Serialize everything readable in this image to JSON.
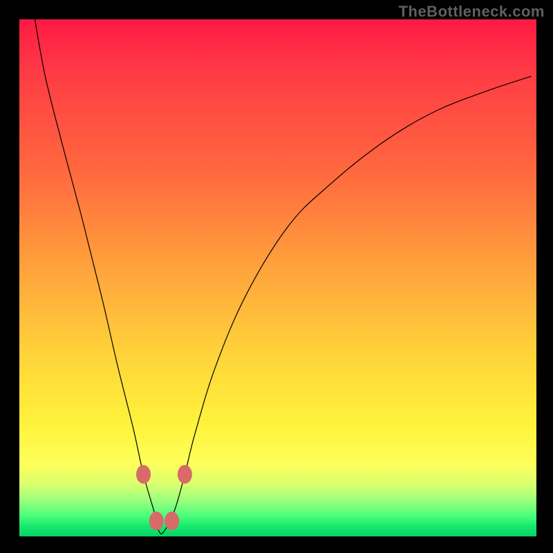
{
  "watermark": "TheBottleneck.com",
  "chart_data": {
    "type": "line",
    "title": "",
    "xlabel": "",
    "ylabel": "",
    "xlim": [
      0,
      100
    ],
    "ylim": [
      0,
      100
    ],
    "series": [
      {
        "name": "bottleneck-curve",
        "x": [
          3,
          5,
          8,
          12,
          16,
          19,
          22,
          24,
          26,
          27,
          28,
          30,
          32,
          34,
          38,
          44,
          52,
          60,
          70,
          80,
          90,
          99
        ],
        "values": [
          100,
          89,
          77,
          62,
          46,
          33,
          21,
          12,
          5,
          1,
          1,
          5,
          12,
          20,
          33,
          47,
          60,
          68,
          76,
          82,
          86,
          89
        ]
      }
    ],
    "markers": [
      {
        "name": "left-shoulder-upper",
        "x": 24.0,
        "y": 12
      },
      {
        "name": "left-shoulder-lower",
        "x": 26.5,
        "y": 3
      },
      {
        "name": "right-shoulder-lower",
        "x": 29.5,
        "y": 3
      },
      {
        "name": "right-shoulder-upper",
        "x": 32.0,
        "y": 12
      }
    ],
    "marker_color": "#d86a6a",
    "curve_color": "#000000"
  }
}
